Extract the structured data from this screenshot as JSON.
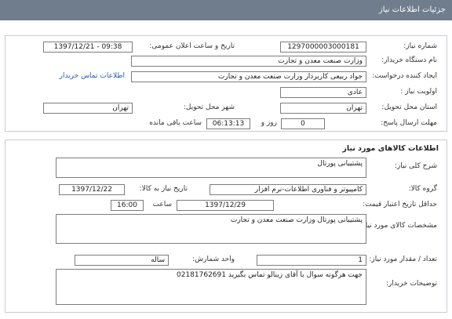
{
  "window": {
    "title": "جزئیات اطلاعات نیاز"
  },
  "need_info": {
    "need_number_label": "شماره نیاز:",
    "need_number": "1297000003000181",
    "announce_datetime_label": "تاریخ و ساعت اعلان عمومی:",
    "announce_datetime": "1397/12/21 - 09:38",
    "buyer_org_label": "نام دستگاه خریدار:",
    "buyer_org": "وزارت صنعت معدن و تجارت",
    "requester_label": "ایجاد کننده درخواست:",
    "requester": "جواد ربیعی کاربردار وزارت صنعت معدن و تجارت",
    "buyer_contact_link": "اطلاعات تماس خریدار",
    "priority_label": "اولویت نیاز :",
    "priority": "عادی",
    "province_label": "استان محل تحویل:",
    "province": "تهران",
    "city_label": "شهر محل تحویل:",
    "city": "تهران",
    "deadline_label": "مهلت ارسال پاسخ:",
    "days_value": "0",
    "days_unit": "روز و",
    "time_remaining": "06:13:13",
    "remaining_label": "ساعت باقی مانده"
  },
  "goods_info": {
    "section_title": "اطلاعات کالاهای مورد نیاز",
    "general_desc_label": "شرح کلی نیاز:",
    "general_desc": "پشتیبانی پورتال",
    "goods_group_label": "گروه کالا:",
    "goods_group": "کامپیوتر و فناوری اطلاعات-نرم افزار",
    "need_date_label": "تاریخ نیاز به کالا:",
    "need_date": "1397/12/22",
    "min_price_validity_label": "حداقل تاریخ اعتبار قیمت:",
    "min_price_validity_date": "1397/12/29",
    "time_label": "ساعت",
    "min_price_validity_time": "16:00",
    "specs_label": "مشخصات کالای مورد نیاز:",
    "specs": "پشتیبانی پورتال وزارت صنعت معدن و تجارت",
    "quantity_label": "تعداد / مقدار مورد نیاز:",
    "quantity": "1",
    "unit_label": "واحد شمارش:",
    "unit": "ساله",
    "buyer_notes_label": "توضیحات خریدار:",
    "buyer_notes": "جهت هرگونه سوال با آقای زینالو تماس بگیرید 02181762691"
  }
}
